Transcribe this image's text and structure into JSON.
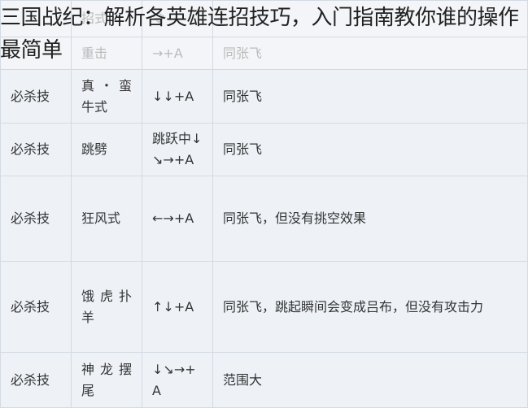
{
  "title": "三国战纪：解析各英雄连招技巧，入门指南教你谁的操作最简单",
  "header": {
    "col1": "招式",
    "col2": "令"
  },
  "rows": [
    {
      "type": "",
      "name": "重击",
      "command": "→+A",
      "note": "同张飞",
      "faded": true
    },
    {
      "type": "必杀技",
      "name": "真・蛮牛式",
      "command": "↓↓+A",
      "note": "同张飞"
    },
    {
      "type": "必杀技",
      "name": "跳劈",
      "command": "跳跃中↓↘→+A",
      "note": "同张飞"
    },
    {
      "type": "必杀技",
      "name": "狂风式",
      "command": "←→+A",
      "note": "同张飞，但没有挑空效果"
    },
    {
      "type": "必杀技",
      "name": "饿虎扑羊",
      "command": "↑↓+A",
      "note": "同张飞，跳起瞬间会变成吕布，但没有攻击力"
    },
    {
      "type": "必杀技",
      "name": "神龙摆尾",
      "command": "↓↘→+A",
      "note": "范围大"
    }
  ]
}
